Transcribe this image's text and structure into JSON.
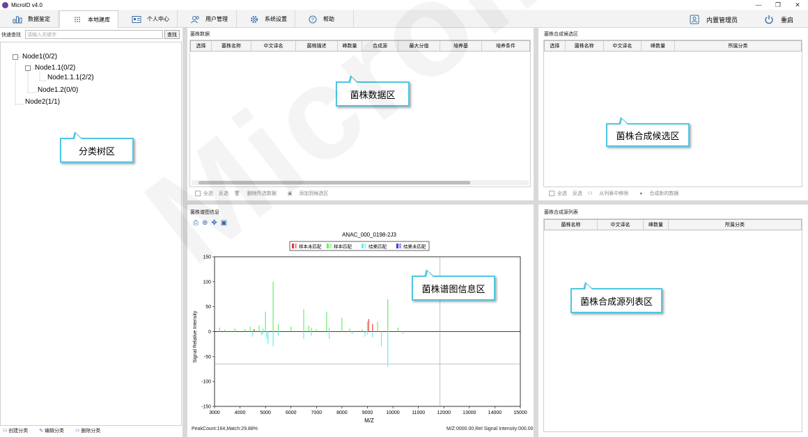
{
  "app": {
    "title": "MicroID v4.0",
    "watermark": "MicroID"
  },
  "menu": {
    "tabs": [
      {
        "label": "数据鉴定",
        "icon": "bar-chart-icon"
      },
      {
        "label": "本地建库",
        "icon": "database-icon"
      },
      {
        "label": "个人中心",
        "icon": "id-card-icon"
      },
      {
        "label": "用户管理",
        "icon": "users-icon"
      },
      {
        "label": "系统设置",
        "icon": "gear-icon"
      },
      {
        "label": "帮助",
        "icon": "help-icon"
      }
    ],
    "user_label": "内置管理员",
    "restart_label": "重启"
  },
  "left": {
    "quick_search_label": "快速查找",
    "search_placeholder": "请输入关键字",
    "search_button": "查找",
    "tree": [
      "Node1(0/2)",
      "Node1.1(0/2)",
      "Node1.1.1(2/2)",
      "Node1.2(0/0)",
      "Node2(1/1)"
    ],
    "callout": "分类树区",
    "footer": {
      "create": "创建分类",
      "edit": "编辑分类",
      "delete": "删除分类"
    }
  },
  "strain": {
    "title": "菌株数据",
    "columns": [
      "选择",
      "菌株名称",
      "中文译名",
      "菌株描述",
      "峰数量",
      "合成源",
      "最大分值",
      "培养基",
      "培养条件"
    ],
    "callout": "菌株数据区",
    "toolbar": {
      "select_all": "全选",
      "invert": "反选",
      "delete": "删除所选数据",
      "add": "添加到候选区"
    }
  },
  "candidate": {
    "title": "菌株合成候选区",
    "columns": [
      "选择",
      "菌株名称",
      "中文译名",
      "峰数量",
      "所属分类"
    ],
    "callout": "菌株合成候选区",
    "toolbar": {
      "select_all": "全选",
      "invert": "反选",
      "remove": "从列表中移除",
      "synth": "合成新的数据"
    }
  },
  "spectrum": {
    "title": "菌株谱图信息",
    "callout": "菌株谱图信息区",
    "status_left": "PeakCount:164,Match:29.88%",
    "status_right": "M/Z:0000.00,Rel Signal Intensity:000.00"
  },
  "source": {
    "title": "菌株合成源列表",
    "columns": [
      "菌株名称",
      "中文译名",
      "峰数量",
      "所属分类"
    ],
    "callout": "菌株合成源列表区"
  },
  "chart_data": {
    "type": "bar",
    "title": "ANAC_000_0198-2J3",
    "xlabel": "M/Z",
    "ylabel": "Signal Relative Intensity",
    "xlim": [
      3000,
      15000
    ],
    "ylim": [
      -150,
      150
    ],
    "xticks": [
      3000,
      4000,
      5000,
      6000,
      7000,
      8000,
      9000,
      10000,
      11000,
      12000,
      13000,
      14000,
      15000
    ],
    "yticks": [
      150,
      100,
      50,
      0,
      -50,
      -100,
      -150
    ],
    "legend": [
      {
        "name": "样本未匹配",
        "color": "#e53935"
      },
      {
        "name": "样本匹配",
        "color": "#66ee66"
      },
      {
        "name": "结果匹配",
        "color": "#66eeee"
      },
      {
        "name": "结果未匹配",
        "color": "#3b3be0"
      }
    ],
    "cursor_x": 11850,
    "threshold_y": -65,
    "series": [
      {
        "name": "样本未匹配",
        "x": [
          4550,
          9050,
          9200
        ],
        "y": [
          5,
          25,
          15
        ]
      },
      {
        "name": "样本匹配",
        "x": [
          3200,
          3400,
          3800,
          4200,
          4400,
          4750,
          4900,
          5000,
          5300,
          5500,
          6000,
          6500,
          6700,
          6800,
          7000,
          7400,
          7500,
          8000,
          8300,
          8800,
          9000,
          9400,
          9800,
          10200
        ],
        "y": [
          8,
          4,
          6,
          5,
          10,
          12,
          6,
          40,
          100,
          15,
          10,
          45,
          12,
          8,
          5,
          40,
          8,
          28,
          6,
          5,
          20,
          20,
          65,
          8
        ]
      },
      {
        "name": "结果匹配",
        "x": [
          4500,
          4850,
          4900,
          5050,
          5100,
          5300,
          5500,
          6500,
          6800,
          7500,
          8400,
          8900,
          9000,
          9200,
          9550,
          9800,
          10400
        ],
        "y": [
          -10,
          -8,
          -5,
          -15,
          -25,
          -30,
          -8,
          -15,
          -8,
          -15,
          -5,
          -10,
          -6,
          -12,
          -30,
          -70,
          -5
        ]
      },
      {
        "name": "结果未匹配",
        "x": [],
        "y": []
      }
    ]
  }
}
